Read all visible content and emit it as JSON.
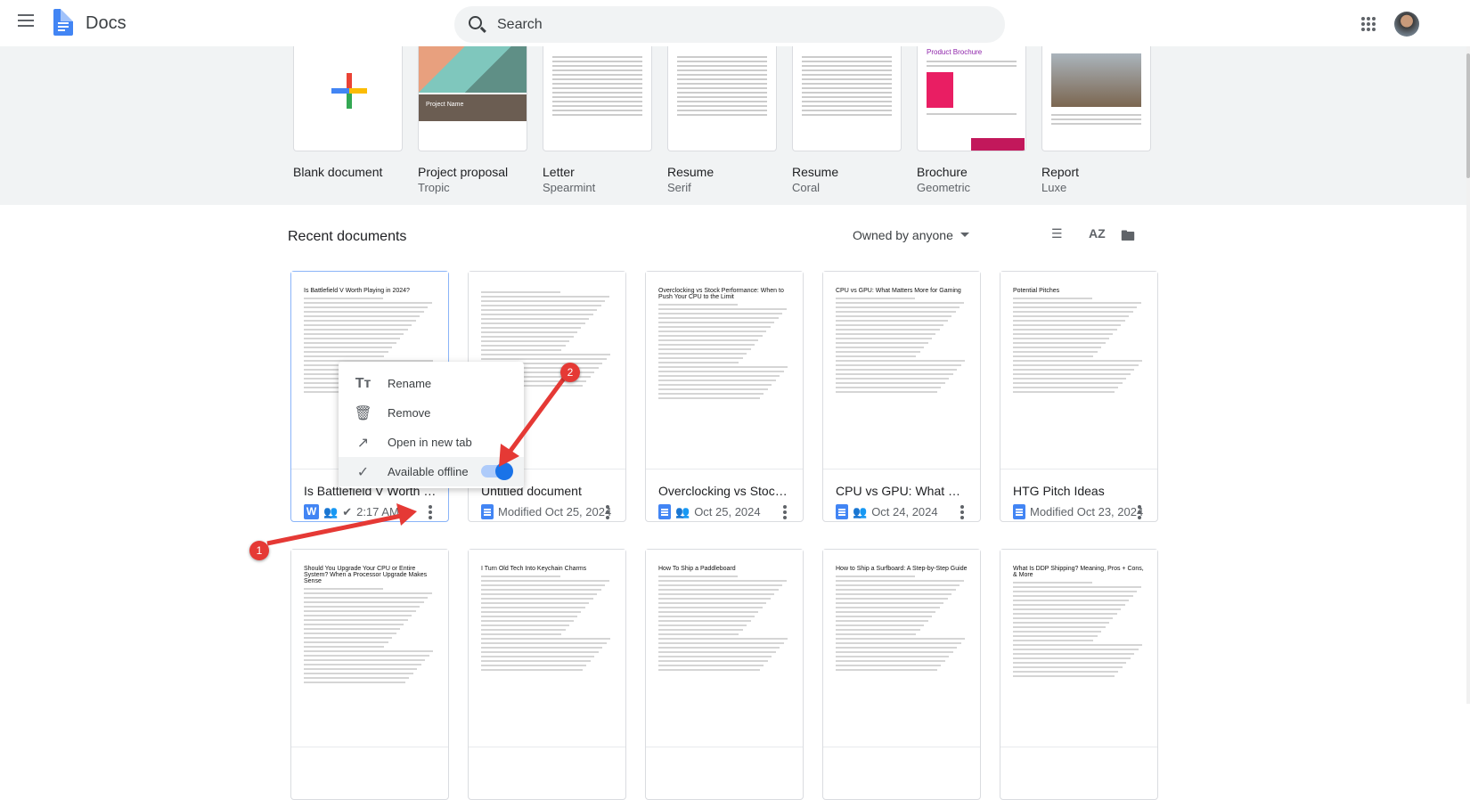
{
  "header": {
    "app_name": "Docs",
    "search_placeholder": "Search"
  },
  "templates": [
    {
      "name": "Blank document",
      "sub": ""
    },
    {
      "name": "Project proposal",
      "sub": "Tropic",
      "thumb_title": "Project Name"
    },
    {
      "name": "Letter",
      "sub": "Spearmint"
    },
    {
      "name": "Resume",
      "sub": "Serif"
    },
    {
      "name": "Resume",
      "sub": "Coral"
    },
    {
      "name": "Brochure",
      "sub": "Geometric",
      "thumb_title": "Product Brochure"
    },
    {
      "name": "Report",
      "sub": "Luxe"
    }
  ],
  "recent": {
    "heading": "Recent documents",
    "owner_filter": "Owned by anyone",
    "sort_icon": "AZ"
  },
  "documents": [
    {
      "title": "Is Battlefield V Worth Playing in 2024?",
      "meta": "2:17 AM",
      "icon": "word-icon",
      "thumb": "Is Battlefield V Worth Playing in 2024?"
    },
    {
      "title": "Untitled document",
      "meta": "Modified Oct 25, 2024",
      "icon": "docs-icon",
      "thumb": ""
    },
    {
      "title": "Overclocking vs Stock Performance: When to Push Your CPU to the Limit",
      "meta": "Oct 25, 2024",
      "icon": "docs-icon",
      "thumb": "Overclocking vs Stock Performance: When to Push Your CPU to the Limit"
    },
    {
      "title": "CPU vs GPU: What Matters More for Gaming",
      "meta": "Oct 24, 2024",
      "icon": "docs-icon",
      "thumb": "CPU vs GPU: What Matters More for Gaming"
    },
    {
      "title": "HTG Pitch Ideas",
      "meta": "Modified Oct 23, 2024",
      "icon": "docs-icon",
      "thumb": "Potential Pitches"
    },
    {
      "thumb": "Should You Upgrade Your CPU or Entire System? When a Processor Upgrade Makes Sense"
    },
    {
      "thumb": "I Turn Old Tech Into Keychain Charms"
    },
    {
      "thumb": "How To Ship a Paddleboard"
    },
    {
      "thumb": "How to Ship a Surfboard: A Step-by-Step Guide"
    },
    {
      "thumb": "What Is DDP Shipping? Meaning, Pros + Cons, & More"
    }
  ],
  "context_menu": {
    "items": [
      {
        "label": "Rename",
        "icon": "rename-icon"
      },
      {
        "label": "Remove",
        "icon": "trash-icon"
      },
      {
        "label": "Open in new tab",
        "icon": "open-new-tab-icon"
      },
      {
        "label": "Available offline",
        "icon": "offline-icon",
        "toggle_on": true
      }
    ]
  },
  "annotations": [
    "1",
    "2"
  ],
  "colors": {
    "accent": "#1a73e8",
    "docs_blue": "#4285f4",
    "annotation": "#e53935"
  }
}
